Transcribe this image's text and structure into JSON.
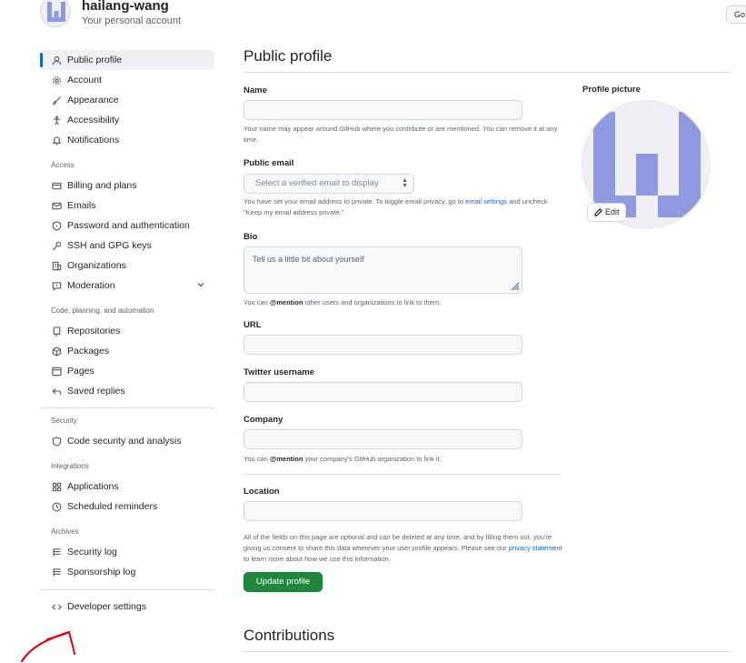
{
  "account": {
    "username": "hailang-wang",
    "subtitle": "Your personal account",
    "goto_label": "Go t"
  },
  "sidebar": {
    "top_items": [
      {
        "label": "Public profile",
        "icon": "person-icon",
        "active": true
      },
      {
        "label": "Account",
        "icon": "gear-icon"
      },
      {
        "label": "Appearance",
        "icon": "paintbrush-icon"
      },
      {
        "label": "Accessibility",
        "icon": "accessibility-icon"
      },
      {
        "label": "Notifications",
        "icon": "bell-icon"
      }
    ],
    "access_title": "Access",
    "access_items": [
      {
        "label": "Billing and plans",
        "icon": "credit-card-icon"
      },
      {
        "label": "Emails",
        "icon": "mail-icon"
      },
      {
        "label": "Password and authentication",
        "icon": "shield-lock-icon"
      },
      {
        "label": "SSH and GPG keys",
        "icon": "key-icon"
      },
      {
        "label": "Organizations",
        "icon": "organization-icon"
      },
      {
        "label": "Moderation",
        "icon": "report-icon"
      }
    ],
    "code_title": "Code, planning, and automation",
    "code_items": [
      {
        "label": "Repositories",
        "icon": "repo-icon"
      },
      {
        "label": "Packages",
        "icon": "package-icon"
      },
      {
        "label": "Pages",
        "icon": "browser-icon"
      },
      {
        "label": "Saved replies",
        "icon": "reply-icon"
      }
    ],
    "security_title": "Security",
    "security_items": [
      {
        "label": "Code security and analysis",
        "icon": "codescan-icon"
      }
    ],
    "integrations_title": "Integrations",
    "integrations_items": [
      {
        "label": "Applications",
        "icon": "apps-icon"
      },
      {
        "label": "Scheduled reminders",
        "icon": "clock-icon"
      }
    ],
    "archives_title": "Archives",
    "archives_items": [
      {
        "label": "Security log",
        "icon": "log-icon"
      },
      {
        "label": "Sponsorship log",
        "icon": "log-icon"
      }
    ],
    "developer_settings": "Developer settings"
  },
  "main": {
    "title": "Public profile",
    "name_label": "Name",
    "name_value": "",
    "name_help": "Your name may appear around GitHub where you contribute or are mentioned. You can remove it at any time.",
    "email_label": "Public email",
    "email_select": "Select a verified email to display",
    "email_help_1": "You have set your email address to private. To toggle email privacy, go to ",
    "email_help_link": "email settings",
    "email_help_2": " and uncheck \"Keep my email address private.\"",
    "bio_label": "Bio",
    "bio_placeholder": "Tell us a little bit about yourself",
    "bio_help_1": "You can ",
    "bio_help_mention": "@mention",
    "bio_help_2": " other users and organizations to link to them.",
    "url_label": "URL",
    "twitter_label": "Twitter username",
    "company_label": "Company",
    "company_help_1": "You can ",
    "company_help_mention": "@mention",
    "company_help_2": " your company's GitHub organization to link it.",
    "location_label": "Location",
    "consent_1": "All of the fields on this page are optional and can be deleted at any time, and by filling them out, you're giving us consent to share this data wherever your user profile appears. Please see our ",
    "consent_link": "privacy statement",
    "consent_2": " to learn more about how we use this information.",
    "update_button": "Update profile",
    "contributions_title": "Contributions"
  },
  "profile_picture": {
    "label": "Profile picture",
    "edit_label": "Edit"
  },
  "colors": {
    "accent": "#0969da",
    "primary_button": "#1f883d",
    "identicon": "#8f99e0",
    "annotation": "#e3000f"
  }
}
